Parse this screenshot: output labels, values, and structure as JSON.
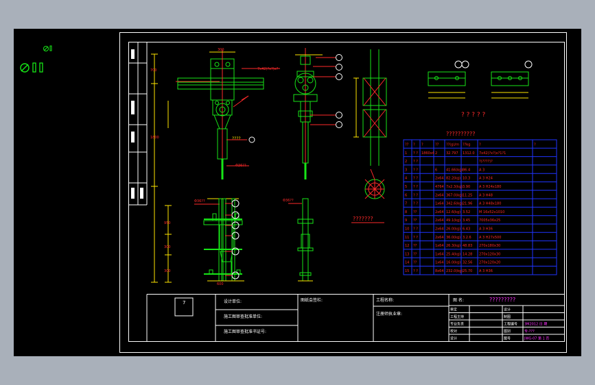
{
  "sheet": {
    "material_table_title": "??????????",
    "notes_title": "? ? ? ? ?",
    "section_title": "???????",
    "drawing_name": "?????????",
    "box_number": "7"
  },
  "material_table": {
    "headers": [
      "??",
      "?",
      "?",
      "??",
      "??(g)/m",
      "??kg",
      "?",
      "?"
    ],
    "rows": [
      [
        "1",
        "? ?",
        "1860x4",
        "2",
        "32.797",
        "1312.0",
        "7x42(?x?)x?1?1",
        ""
      ],
      [
        "2",
        "? ?",
        "",
        "",
        "",
        "",
        "?(????)?",
        ""
      ],
      [
        "3",
        "? ?",
        "",
        "6",
        "41.66(kg)",
        "86.4",
        "A 3",
        ""
      ],
      [
        "4",
        "? ?",
        "",
        "2x64",
        "82.2(kg)",
        "10.3",
        "A 3 H24",
        ""
      ],
      [
        "5",
        "? ?",
        "",
        "4764",
        "7x2.3(kg)",
        "3.90",
        "A 3 H24x180",
        ""
      ],
      [
        "6",
        "? ?",
        "",
        "2x64",
        "367.0(kg)",
        "11.25",
        "A 3 H48",
        ""
      ],
      [
        "7",
        "? ?",
        "",
        "1x64",
        "342.6(kg)",
        "21.96",
        "A 3 H48x180",
        ""
      ],
      [
        "8",
        "??",
        "",
        "2x64",
        "12.6(kg)",
        "3.52",
        "M 16x52x1010",
        ""
      ],
      [
        "9",
        "??",
        "",
        "2x64",
        "49.1(kg)",
        "3.45",
        "7005x36x25",
        ""
      ],
      [
        "10",
        "? ?",
        "",
        "2x64",
        "26.0(kg)",
        "6.43",
        "A 3 H36",
        ""
      ],
      [
        "11",
        "? ?",
        "",
        "2x64",
        "36.0(kg)",
        "3.2.6",
        "A 3 H27x500",
        ""
      ],
      [
        "12",
        "??",
        "",
        "1x64",
        "26.3(kg)",
        "48.83",
        "270x180x30",
        ""
      ],
      [
        "13",
        "??",
        "",
        "1x64",
        "25.4(kg)",
        "14.28",
        "270x120x30",
        ""
      ],
      [
        "14",
        "??",
        "",
        "1x64",
        "16.0(kg)",
        "32.56",
        "270x120x20",
        ""
      ],
      [
        "15",
        "? ?",
        "",
        "8x64",
        "232.0(kg)",
        "25.70",
        "A 3 H36",
        ""
      ]
    ]
  },
  "callouts": {
    "top_dim": "7x42(?x?)x?",
    "rod_label": "????",
    "dia1": "Φ36??",
    "dia2": "Φ36??",
    "dia3": "Φ36??",
    "dia4": "Φ36??"
  },
  "title_block": {
    "design_unit": "设计单位:",
    "construction_unit": "施工图审查批准单位:",
    "approval_cert": "施工图审查批准书证号:",
    "approval_stamp": "图纸会签栏:",
    "project_name": "工程名称:",
    "drawing_title_label": "图  名:",
    "stamp_area": "注册师执业章:",
    "rows": [
      [
        "审定",
        "",
        "设计",
        ""
      ],
      [
        "工程主持",
        "",
        "制图",
        ""
      ],
      [
        "专业负责",
        "",
        "工程编号",
        "3M2012  日  期"
      ],
      [
        "校对",
        "",
        "图别",
        "专-???"
      ],
      [
        "设计",
        "",
        "图号",
        "JWG-07  第 1 页"
      ]
    ]
  }
}
